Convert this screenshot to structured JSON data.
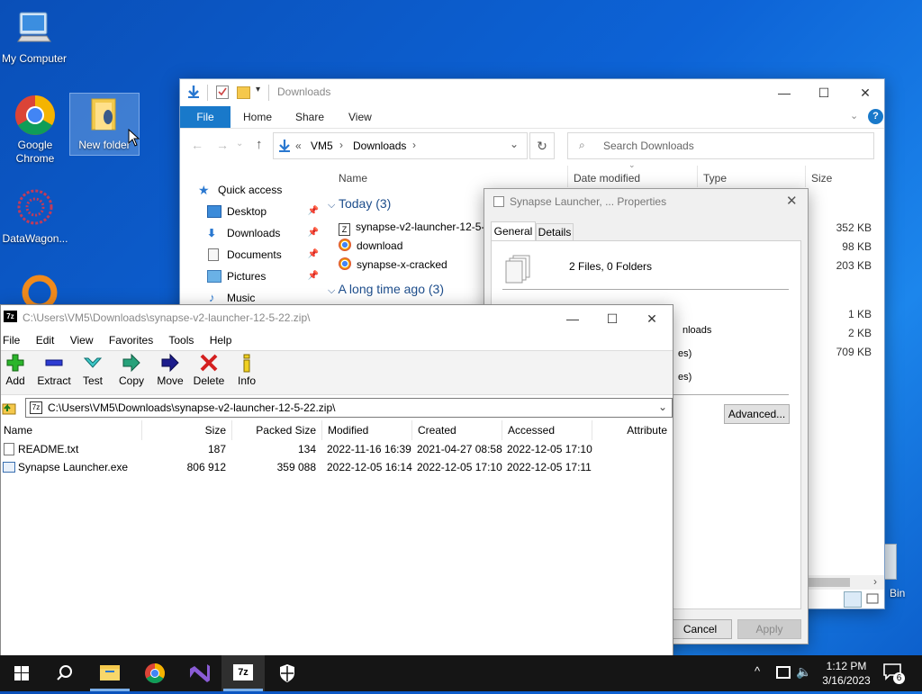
{
  "desktop": {
    "icons": [
      {
        "label": "My Computer"
      },
      {
        "label": "Google Chrome"
      },
      {
        "label": "New folder"
      },
      {
        "label": "DataWagon..."
      },
      {
        "label": "Bin"
      }
    ]
  },
  "explorer": {
    "title": "Downloads",
    "ribbon_tabs": [
      "File",
      "Home",
      "Share",
      "View"
    ],
    "address": {
      "prefix": "«",
      "parts": [
        "VM5",
        "Downloads"
      ]
    },
    "search_placeholder": "Search Downloads",
    "nav": [
      {
        "label": "Quick access"
      },
      {
        "label": "Desktop"
      },
      {
        "label": "Downloads"
      },
      {
        "label": "Documents"
      },
      {
        "label": "Pictures"
      },
      {
        "label": "Music"
      }
    ],
    "columns": [
      "Name",
      "Date modified",
      "Type",
      "Size"
    ],
    "groups": [
      {
        "label": "Today (3)"
      },
      {
        "label": "A long time ago (3)"
      }
    ],
    "files_today": [
      {
        "name": "synapse-v2-launcher-12-5-",
        "size": "352 KB"
      },
      {
        "name": "download",
        "size": "98 KB"
      },
      {
        "name": "synapse-x-cracked",
        "size": "203 KB"
      }
    ],
    "older_sizes": [
      "1 KB",
      "2 KB",
      "709 KB"
    ]
  },
  "properties": {
    "title": "Synapse Launcher, ... Properties",
    "tabs": [
      "General",
      "Details"
    ],
    "summary": "2 Files, 0 Folders",
    "partial_lines": [
      "nloads",
      "es)",
      "es)"
    ],
    "advanced_label": "Advanced...",
    "cancel_label": "Cancel",
    "apply_label": "Apply"
  },
  "sevenzip": {
    "title": "C:\\Users\\VM5\\Downloads\\synapse-v2-launcher-12-5-22.zip\\",
    "menu": [
      "File",
      "Edit",
      "View",
      "Favorites",
      "Tools",
      "Help"
    ],
    "toolbar": [
      "Add",
      "Extract",
      "Test",
      "Copy",
      "Move",
      "Delete",
      "Info"
    ],
    "path": "C:\\Users\\VM5\\Downloads\\synapse-v2-launcher-12-5-22.zip\\",
    "columns": [
      "Name",
      "Size",
      "Packed Size",
      "Modified",
      "Created",
      "Accessed",
      "Attribute"
    ],
    "rows": [
      {
        "name": "README.txt",
        "size": "187",
        "packed": "134",
        "modified": "2022-11-16 16:39",
        "created": "2021-04-27 08:58",
        "accessed": "2022-12-05 17:10"
      },
      {
        "name": "Synapse Launcher.exe",
        "size": "806 912",
        "packed": "359 088",
        "modified": "2022-12-05 16:14",
        "created": "2022-12-05 17:10",
        "accessed": "2022-12-05 17:11"
      }
    ]
  },
  "taskbar": {
    "time": "1:12 PM",
    "date": "3/16/2023",
    "notification_count": "6"
  }
}
